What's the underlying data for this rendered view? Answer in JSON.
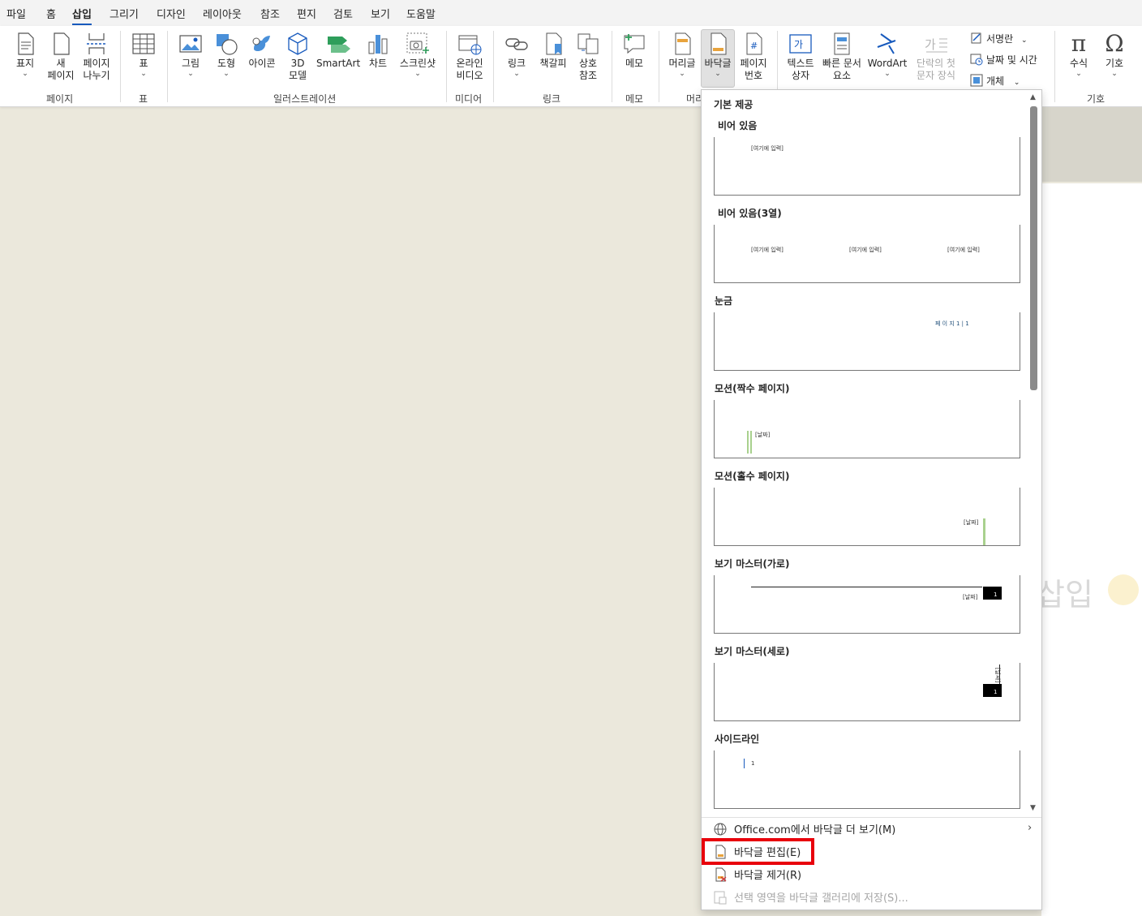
{
  "menu": {
    "tabs": [
      "파일",
      "홈",
      "삽입",
      "그리기",
      "디자인",
      "레이아웃",
      "참조",
      "편지",
      "검토",
      "보기",
      "도움말"
    ],
    "active_tab": "삽입"
  },
  "ribbon": {
    "pages": {
      "cover": "표지",
      "new_page_1": "새",
      "new_page_2": "페이지",
      "break_1": "페이지",
      "break_2": "나누기",
      "group": "페이지"
    },
    "table": {
      "label": "표",
      "group": "표"
    },
    "illustrations": {
      "picture": "그림",
      "shapes": "도형",
      "icons": "아이콘",
      "model_1": "3D",
      "model_2": "모델",
      "smartart": "SmartArt",
      "chart": "차트",
      "screenshot": "스크린샷",
      "group": "일러스트레이션"
    },
    "media": {
      "video_1": "온라인",
      "video_2": "비디오",
      "group": "미디어"
    },
    "links": {
      "link": "링크",
      "bookmark": "책갈피",
      "xref_1": "상호",
      "xref_2": "참조",
      "group": "링크"
    },
    "comments": {
      "comment": "메모",
      "group": "메모"
    },
    "header_footer": {
      "header": "머리글",
      "footer": "바닥글",
      "pagenum_1": "페이지",
      "pagenum_2": "번호",
      "group_partial": "머리"
    },
    "text": {
      "textbox_1": "텍스트",
      "textbox_2": "상자",
      "quickparts_1": "빠른 문서",
      "quickparts_2": "요소",
      "wordart": "WordArt",
      "dropcap_1": "단락의 첫",
      "dropcap_2": "문자 장식",
      "signature": "서명란",
      "datetime": "날짜 및 시간",
      "object": "개체"
    },
    "symbols": {
      "equation": "수식",
      "symbol": "기호",
      "group": "기호"
    }
  },
  "document": {
    "text": "삽입"
  },
  "dropdown": {
    "section": "기본 제공",
    "items": [
      {
        "title": "비어 있음",
        "preview": [
          "[여기에 입력]"
        ]
      },
      {
        "title": "비어 있음(3열)",
        "preview": [
          "[여기에 입력]",
          "[여기에 입력]",
          "[여기에 입력]"
        ]
      },
      {
        "title": "눈금",
        "preview": [
          "페 이 지  1 | 1"
        ]
      },
      {
        "title": "모션(짝수 페이지)",
        "preview": [
          "[날짜]"
        ]
      },
      {
        "title": "모션(홀수 페이지)",
        "preview": [
          "[날짜]"
        ]
      },
      {
        "title": "보기 마스터(가로)",
        "preview": [
          "[날짜]",
          "1"
        ]
      },
      {
        "title": "보기 마스터(세로)",
        "preview": [
          "[날짜]",
          "1"
        ]
      },
      {
        "title": "사이드라인",
        "preview": [
          "1"
        ]
      }
    ],
    "commands": {
      "more": "Office.com에서 바닥글 더 보기(M)",
      "edit": "바닥글 편집(E)",
      "remove": "바닥글 제거(R)",
      "save": "선택 영역을 바닥글 갤러리에 저장(S)..."
    }
  },
  "colors": {
    "accent": "#185abd",
    "highlight": "#e8000b",
    "motion_green": "#a9d18e"
  }
}
